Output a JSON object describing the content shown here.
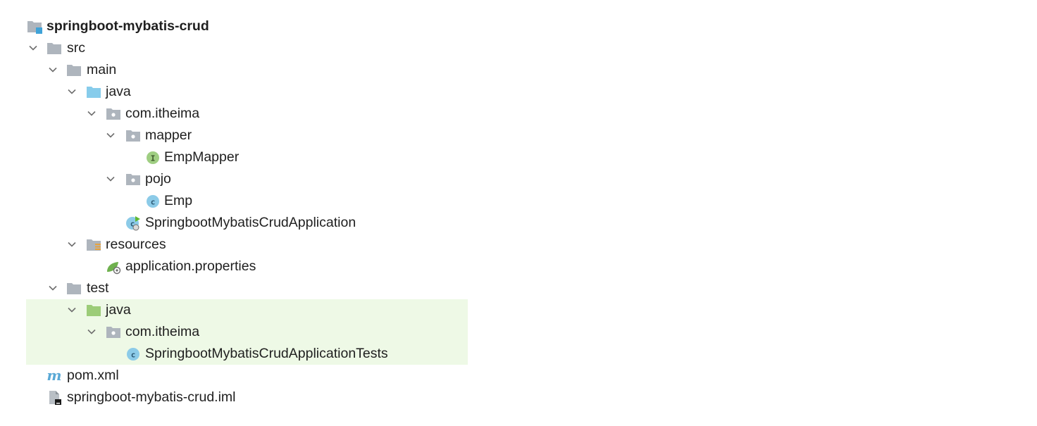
{
  "project_tree": {
    "root": {
      "label": "springboot-mybatis-crud",
      "icon": "project-folder-icon"
    },
    "items": [
      {
        "label": "src",
        "icon": "folder-icon",
        "expanded": true
      },
      {
        "label": "main",
        "icon": "folder-icon",
        "expanded": true
      },
      {
        "label": "java",
        "icon": "source-folder-icon",
        "expanded": true
      },
      {
        "label": "com.itheima",
        "icon": "package-icon",
        "expanded": true
      },
      {
        "label": "mapper",
        "icon": "package-icon",
        "expanded": true
      },
      {
        "label": "EmpMapper",
        "icon": "interface-icon"
      },
      {
        "label": "pojo",
        "icon": "package-icon",
        "expanded": true
      },
      {
        "label": "Emp",
        "icon": "class-icon"
      },
      {
        "label": "SpringbootMybatisCrudApplication",
        "icon": "spring-boot-class-icon"
      },
      {
        "label": "resources",
        "icon": "resources-folder-icon",
        "expanded": true
      },
      {
        "label": "application.properties",
        "icon": "spring-properties-icon"
      },
      {
        "label": "test",
        "icon": "folder-icon",
        "expanded": true
      },
      {
        "label": "java",
        "icon": "test-source-folder-icon",
        "expanded": true
      },
      {
        "label": "com.itheima",
        "icon": "package-icon",
        "expanded": true
      },
      {
        "label": "SpringbootMybatisCrudApplicationTests",
        "icon": "class-icon"
      },
      {
        "label": "pom.xml",
        "icon": "maven-icon"
      },
      {
        "label": "springboot-mybatis-crud.iml",
        "icon": "iml-file-icon"
      }
    ]
  },
  "colors": {
    "folder_gray": "#aeb5bd",
    "source_folder_blue": "#87cceb",
    "test_folder_green": "#9ccc78",
    "class_blue": "#8ccbe8",
    "interface_green": "#9fce82",
    "test_highlight": "#eef9e6",
    "maven_blue": "#5aa9d6"
  }
}
